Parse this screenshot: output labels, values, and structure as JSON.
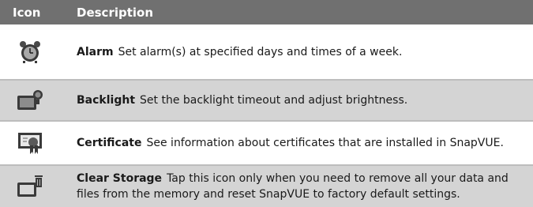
{
  "header": {
    "icon_label": "Icon",
    "description_label": "Description"
  },
  "rows": [
    {
      "title": "Alarm",
      "text": "Set alarm(s) at specified days and times of a week.",
      "icon": "alarm-clock-icon"
    },
    {
      "title": "Backlight",
      "text": "Set the backlight timeout and adjust brightness.",
      "icon": "backlight-icon"
    },
    {
      "title": "Certificate",
      "text": "See information about certificates that are installed in SnapVUE.",
      "icon": "certificate-icon"
    },
    {
      "title": "Clear Storage",
      "text": "Tap this icon only when you need to remove all your data and files from the memory and reset SnapVUE to factory default settings.",
      "icon": "clear-storage-icon"
    }
  ]
}
